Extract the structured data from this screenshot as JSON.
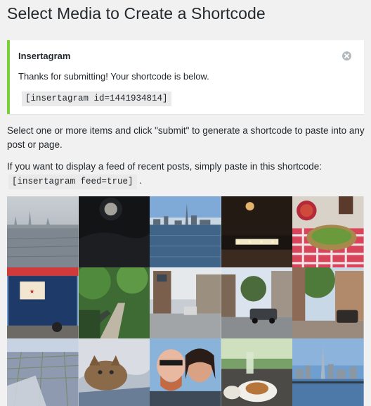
{
  "page": {
    "title": "Select Media to Create a Shortcode"
  },
  "notice": {
    "title": "Insertagram",
    "message": "Thanks for submitting! Your shortcode is below.",
    "shortcode": "[insertagram id=1441934814]",
    "dismiss_icon": "dismiss-icon",
    "accent_color": "#7ad03a"
  },
  "instructions": {
    "select_text": "Select one or more items and click \"submit\" to generate a shortcode to paste into any post or page.",
    "feed_text": "If you want to display a feed of recent posts, simply paste in this shortcode:",
    "feed_shortcode": "[insertagram feed=true]",
    "feed_suffix": "."
  },
  "media": {
    "items": [
      {
        "name": "media-item-city-skyline-fog"
      },
      {
        "name": "media-item-night-moon"
      },
      {
        "name": "media-item-skyline-water"
      },
      {
        "name": "media-item-bar-lights"
      },
      {
        "name": "media-item-food-plate"
      },
      {
        "name": "media-item-food-truck"
      },
      {
        "name": "media-item-park-path"
      },
      {
        "name": "media-item-street-view"
      },
      {
        "name": "media-item-street-cars"
      },
      {
        "name": "media-item-sidewalk-trees"
      },
      {
        "name": "media-item-aerial-view"
      },
      {
        "name": "media-item-cat"
      },
      {
        "name": "media-item-selfie-couple"
      },
      {
        "name": "media-item-lunch-table"
      },
      {
        "name": "media-item-skyline-tower"
      }
    ]
  }
}
